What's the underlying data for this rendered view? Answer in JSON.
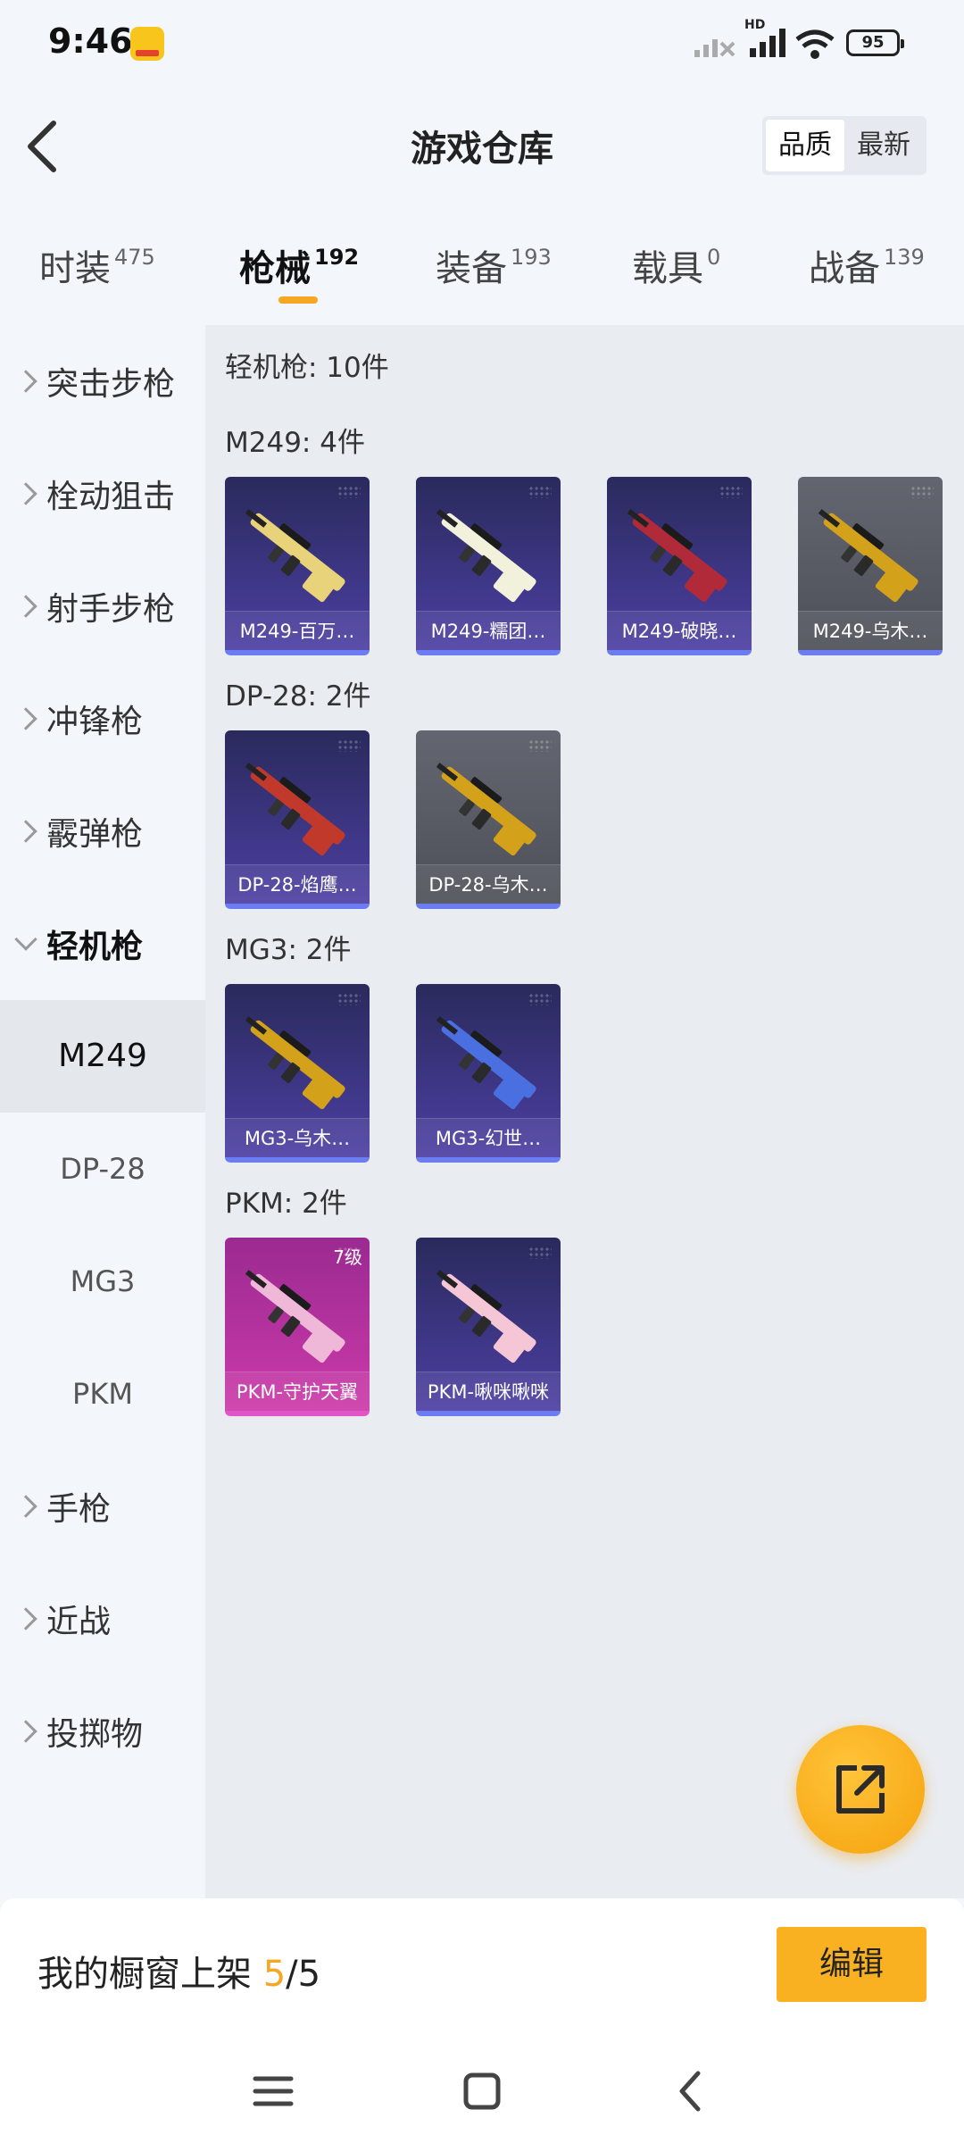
{
  "status_bar": {
    "time": "9:46",
    "hd": "HD",
    "battery": "95"
  },
  "header": {
    "title": "游戏仓库",
    "sort_options": [
      "品质",
      "最新"
    ],
    "sort_active": "品质"
  },
  "tabs": [
    {
      "label": "时装",
      "count": "475"
    },
    {
      "label": "枪械",
      "count": "192",
      "active": true
    },
    {
      "label": "装备",
      "count": "193"
    },
    {
      "label": "载具",
      "count": "0"
    },
    {
      "label": "战备",
      "count": "139"
    }
  ],
  "sidebar": {
    "categories": [
      "突击步枪",
      "栓动狙击",
      "射手步枪",
      "冲锋枪",
      "霰弹枪",
      "轻机枪"
    ],
    "subcategories": [
      "M249",
      "DP-28",
      "MG3",
      "PKM"
    ],
    "active_sub": "M249",
    "more_categories": [
      "手枪",
      "近战",
      "投掷物"
    ]
  },
  "content": {
    "summary": "轻机枪: 10件",
    "groups": [
      {
        "title": "M249: 4件",
        "items": [
          {
            "name": "M249-百万…",
            "style": "purple",
            "color": "#e8d27a"
          },
          {
            "name": "M249-糯团…",
            "style": "purple",
            "color": "#f2f2dc"
          },
          {
            "name": "M249-破晓…",
            "style": "purple",
            "color": "#b02a3a"
          },
          {
            "name": "M249-乌木…",
            "style": "gray",
            "color": "#d4a21a"
          }
        ]
      },
      {
        "title": "DP-28: 2件",
        "items": [
          {
            "name": "DP-28-焰鹰…",
            "style": "purple",
            "color": "#c0392b"
          },
          {
            "name": "DP-28-乌木…",
            "style": "gray",
            "color": "#d4a21a"
          }
        ]
      },
      {
        "title": "MG3: 2件",
        "items": [
          {
            "name": "MG3-乌木…",
            "style": "purple",
            "color": "#d4a21a"
          },
          {
            "name": "MG3-幻世…",
            "style": "purple",
            "color": "#4a6fe0"
          }
        ]
      },
      {
        "title": "PKM: 2件",
        "items": [
          {
            "name": "PKM-守护天翼",
            "style": "pink",
            "color": "#f0b8d8",
            "level": "7级"
          },
          {
            "name": "PKM-啾咪啾咪",
            "style": "purple",
            "color": "#f4c6d6"
          }
        ]
      }
    ]
  },
  "bottom": {
    "showcase_label": "我的橱窗上架 ",
    "showcase_count": "5",
    "showcase_total": "/5",
    "edit_label": "编辑"
  },
  "icons": {
    "back": "back-arrow-icon",
    "share": "share-external-icon",
    "menu": "menu-icon",
    "home": "home-icon",
    "nav_back": "nav-back-icon"
  }
}
